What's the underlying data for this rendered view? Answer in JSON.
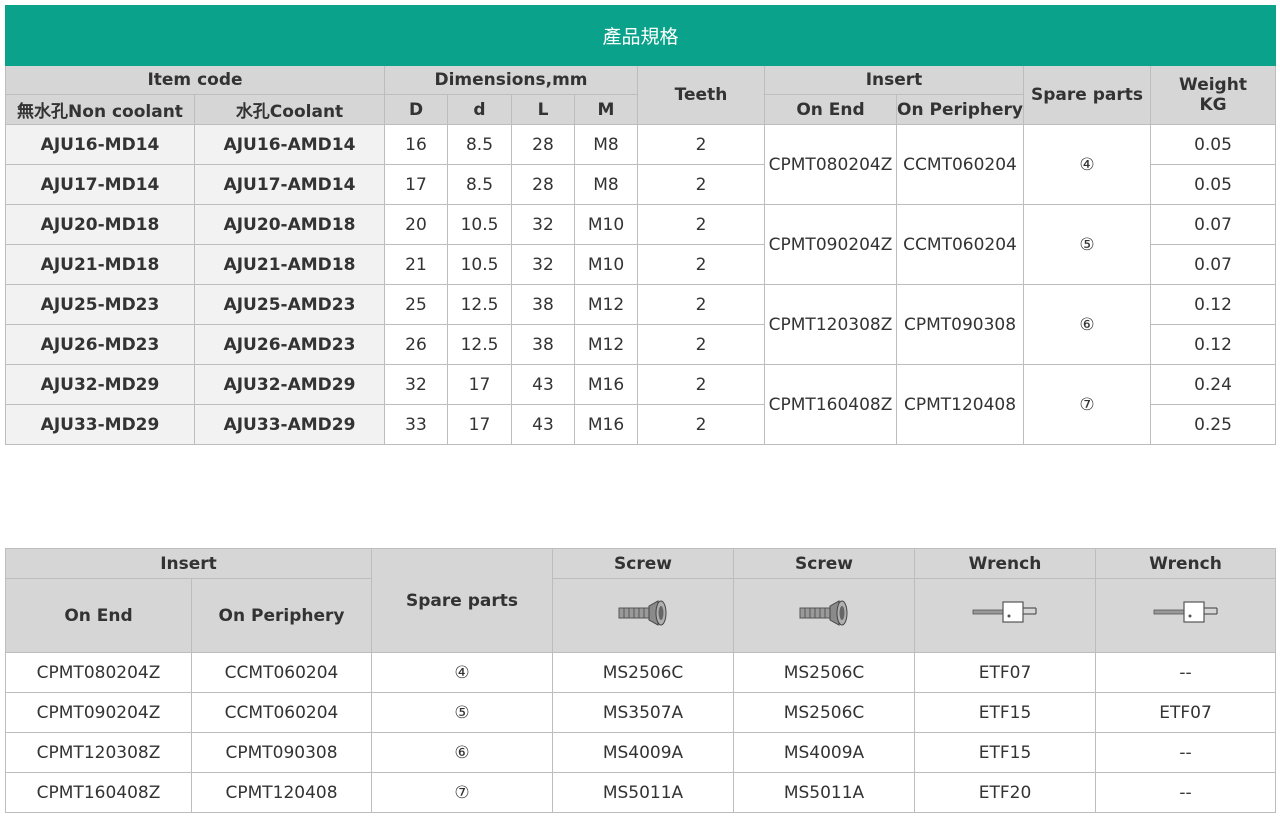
{
  "spec_table": {
    "title": "產品規格",
    "headers": {
      "item_code": "Item code",
      "non_coolant": "無水孔Non coolant",
      "coolant": "水孔Coolant",
      "dimensions": "Dimensions,mm",
      "D": "D",
      "d": "d",
      "L": "L",
      "M": "M",
      "teeth": "Teeth",
      "insert": "Insert",
      "on_end": "On End",
      "on_periphery": "On Periphery",
      "spare_parts": "Spare parts",
      "weight": "Weight",
      "weight_unit": "KG"
    },
    "rows": [
      {
        "non_coolant": "AJU16-MD14",
        "coolant": "AJU16-AMD14",
        "D": "16",
        "d": "8.5",
        "L": "28",
        "M": "M8",
        "teeth": "2",
        "weight": "0.05"
      },
      {
        "non_coolant": "AJU17-MD14",
        "coolant": "AJU17-AMD14",
        "D": "17",
        "d": "8.5",
        "L": "28",
        "M": "M8",
        "teeth": "2",
        "weight": "0.05"
      },
      {
        "non_coolant": "AJU20-MD18",
        "coolant": "AJU20-AMD18",
        "D": "20",
        "d": "10.5",
        "L": "32",
        "M": "M10",
        "teeth": "2",
        "weight": "0.07"
      },
      {
        "non_coolant": "AJU21-MD18",
        "coolant": "AJU21-AMD18",
        "D": "21",
        "d": "10.5",
        "L": "32",
        "M": "M10",
        "teeth": "2",
        "weight": "0.07"
      },
      {
        "non_coolant": "AJU25-MD23",
        "coolant": "AJU25-AMD23",
        "D": "25",
        "d": "12.5",
        "L": "38",
        "M": "M12",
        "teeth": "2",
        "weight": "0.12"
      },
      {
        "non_coolant": "AJU26-MD23",
        "coolant": "AJU26-AMD23",
        "D": "26",
        "d": "12.5",
        "L": "38",
        "M": "M12",
        "teeth": "2",
        "weight": "0.12"
      },
      {
        "non_coolant": "AJU32-MD29",
        "coolant": "AJU32-AMD29",
        "D": "32",
        "d": "17",
        "L": "43",
        "M": "M16",
        "teeth": "2",
        "weight": "0.24"
      },
      {
        "non_coolant": "AJU33-MD29",
        "coolant": "AJU33-AMD29",
        "D": "33",
        "d": "17",
        "L": "43",
        "M": "M16",
        "teeth": "2",
        "weight": "0.25"
      }
    ],
    "insert_groups": [
      {
        "on_end": "CPMT080204Z",
        "on_periphery": "CCMT060204",
        "spare": "④"
      },
      {
        "on_end": "CPMT090204Z",
        "on_periphery": "CCMT060204",
        "spare": "⑤"
      },
      {
        "on_end": "CPMT120308Z",
        "on_periphery": "CPMT090308",
        "spare": "⑥"
      },
      {
        "on_end": "CPMT160408Z",
        "on_periphery": "CPMT120408",
        "spare": "⑦"
      }
    ]
  },
  "spare_table": {
    "headers": {
      "insert": "Insert",
      "on_end": "On End",
      "on_periphery": "On Periphery",
      "spare_parts": "Spare parts",
      "screw_1": "Screw",
      "screw_2": "Screw",
      "wrench_1": "Wrench",
      "wrench_2": "Wrench"
    },
    "icons": [
      "screw-icon",
      "screw-icon",
      "wrench-icon",
      "wrench-icon"
    ],
    "rows": [
      {
        "on_end": "CPMT080204Z",
        "on_periphery": "CCMT060204",
        "spare": "④",
        "screw_1": "MS2506C",
        "screw_2": "MS2506C",
        "wrench_1": "ETF07",
        "wrench_2": "--"
      },
      {
        "on_end": "CPMT090204Z",
        "on_periphery": "CCMT060204",
        "spare": "⑤",
        "screw_1": "MS3507A",
        "screw_2": "MS2506C",
        "wrench_1": "ETF15",
        "wrench_2": "ETF07"
      },
      {
        "on_end": "CPMT120308Z",
        "on_periphery": "CPMT090308",
        "spare": "⑥",
        "screw_1": "MS4009A",
        "screw_2": "MS4009A",
        "wrench_1": "ETF15",
        "wrench_2": "--"
      },
      {
        "on_end": "CPMT160408Z",
        "on_periphery": "CPMT120408",
        "spare": "⑦",
        "screw_1": "MS5011A",
        "screw_2": "MS5011A",
        "wrench_1": "ETF20",
        "wrench_2": "--"
      }
    ]
  },
  "colors": {
    "title_bar": "#0aa28a",
    "header_bg": "#d6d6d6",
    "code_bg": "#f2f2f2",
    "border": "#bdbdbd"
  }
}
